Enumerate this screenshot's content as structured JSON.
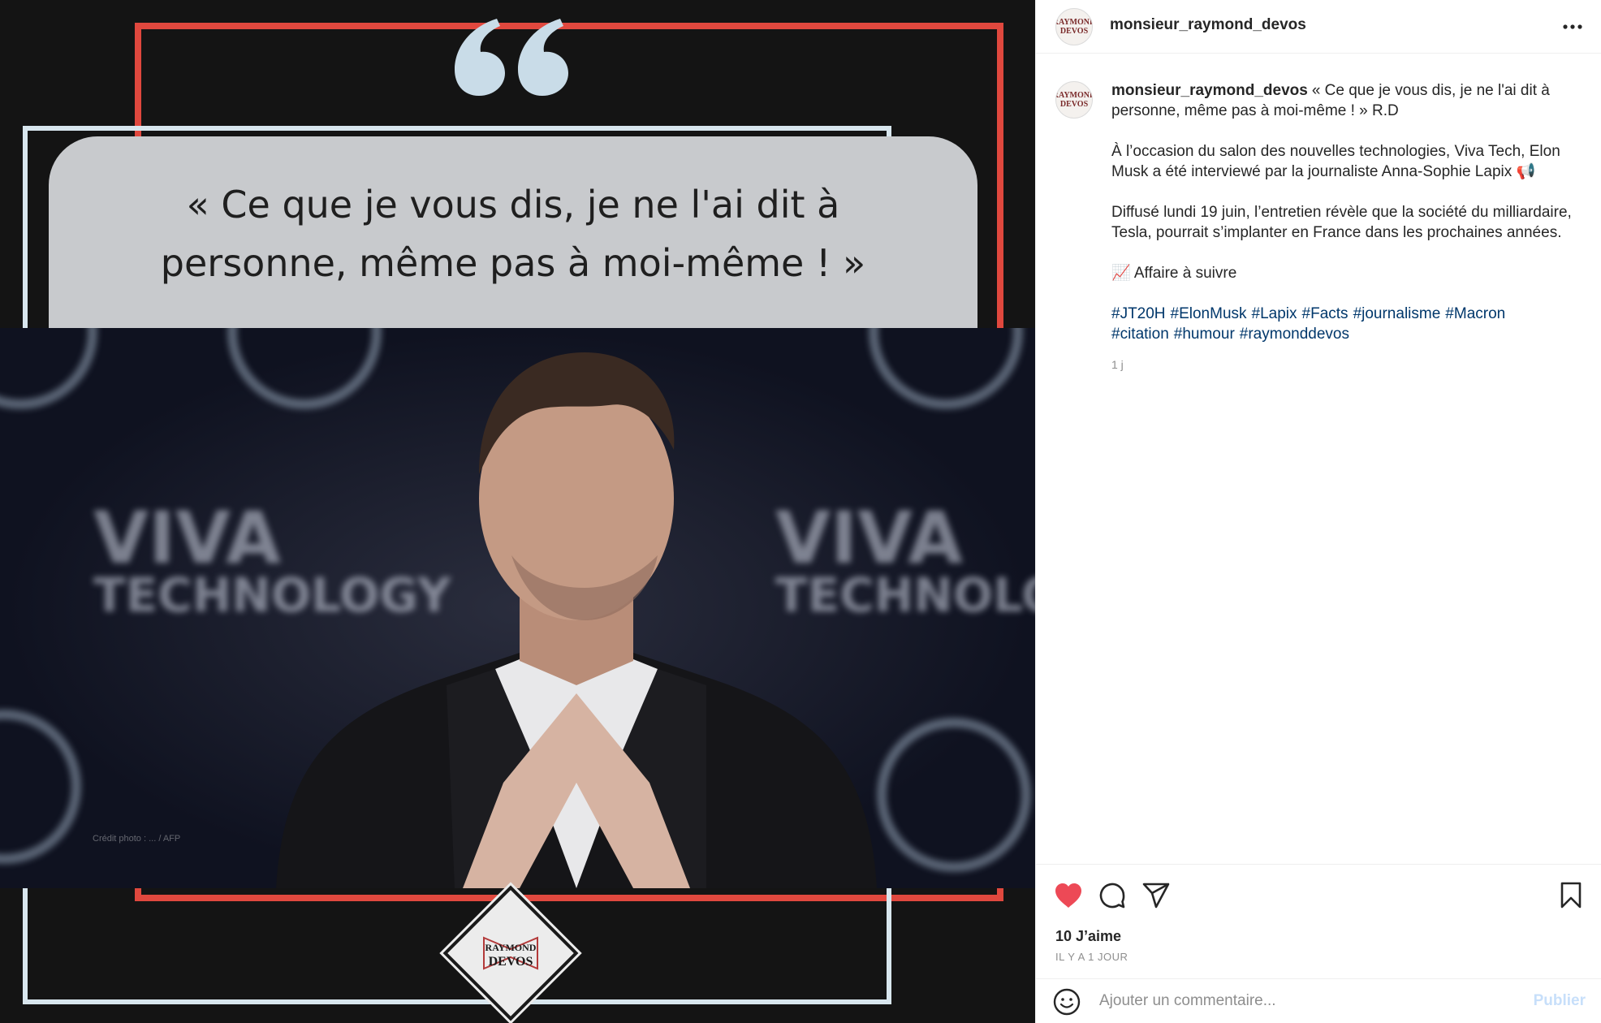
{
  "post": {
    "username": "monsieur_raymond_devos",
    "avatar_text": "RAYMOND DEVOS",
    "image": {
      "quote": "« Ce que je vous dis, je ne l'ai dit à personne, même pas à moi-même ! »",
      "background_words": [
        "VIVA",
        "TECHNOLOGY"
      ],
      "credit": "Crédit photo : ... / AFP",
      "logo_text": "RAYMOND DEVOS"
    },
    "caption": {
      "lead": "« Ce que je vous dis, je ne l'ai dit à personne, même pas à moi-même ! » R.D",
      "para1": "À l’occasion du salon des nouvelles technologies, Viva Tech, Elon Musk a été interviewé par la journaliste Anna-Sophie Lapix 📢",
      "para2": "Diffusé lundi 19 juin, l’entretien révèle que la société du milliardaire, Tesla, pourrait s’implanter en France dans les prochaines années.",
      "para3": "📈 Affaire à suivre",
      "hashtags": [
        "#JT20H",
        "#ElonMusk",
        "#Lapix",
        "#Facts",
        "#journalisme",
        "#Macron",
        "#citation",
        "#humour",
        "#raymonddevos"
      ],
      "time": "1 j"
    },
    "likes": "10 J’aime",
    "ago": "IL Y A 1 JOUR",
    "comment_placeholder": "Ajouter un commentaire...",
    "publish_label": "Publier"
  },
  "colors": {
    "like_red": "#ed4956",
    "link_blue": "#00376b",
    "frame_red": "#e0483e",
    "frame_blue": "#d8e6ee",
    "publish_disabled": "#c7dffa"
  },
  "icons": [
    "more-icon",
    "heart-icon",
    "comment-icon",
    "share-icon",
    "bookmark-icon",
    "emoji-icon",
    "quote-mark-icon"
  ]
}
